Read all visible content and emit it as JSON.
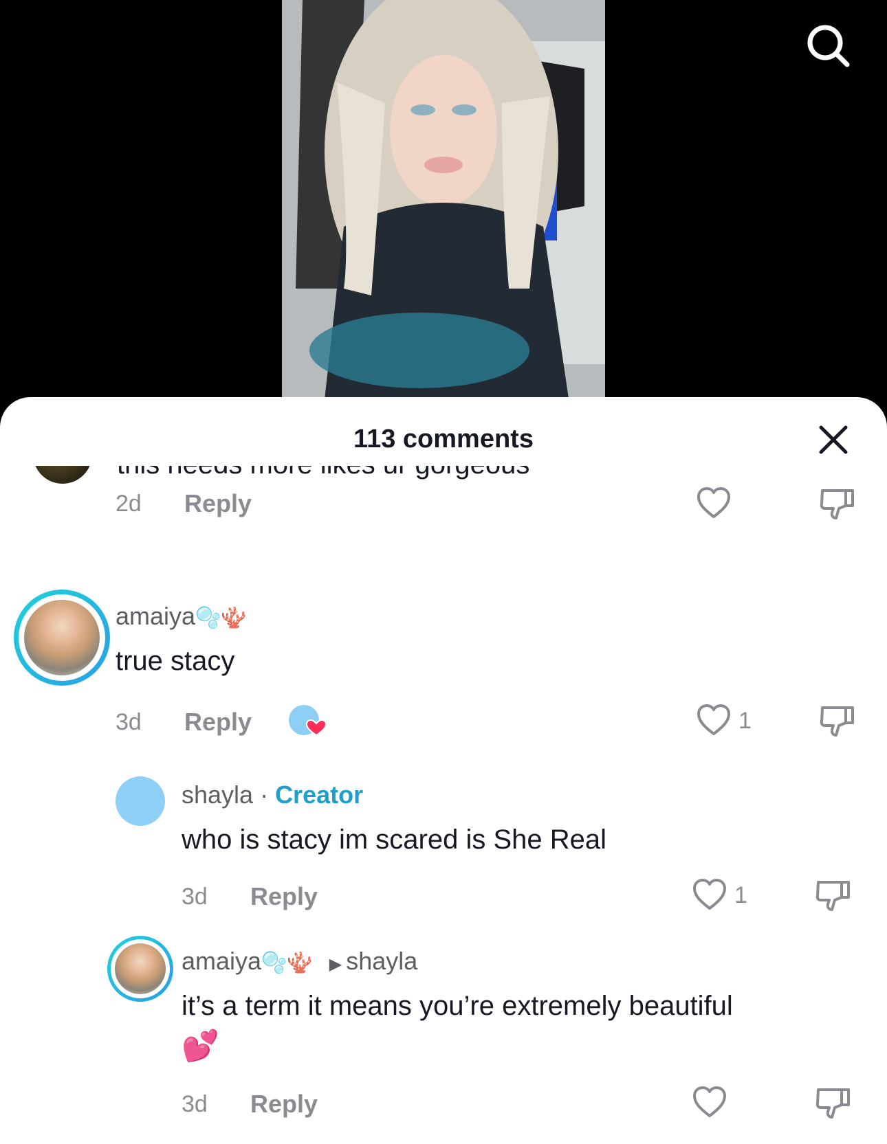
{
  "header": {
    "comments_title": "113 comments"
  },
  "comments": [
    {
      "partial_text": "this needs more likes ur gorgeous",
      "time": "2d",
      "reply_label": "Reply"
    },
    {
      "username": "amaiya",
      "username_emoji": "🫧🪸",
      "text": "true stacy",
      "time": "3d",
      "reply_label": "Reply",
      "likes": "1"
    },
    {
      "username": "shayla",
      "separator": " · ",
      "badge": "Creator",
      "text": "who is stacy im scared is She Real",
      "time": "3d",
      "reply_label": "Reply",
      "likes": "1"
    },
    {
      "username": "amaiya",
      "username_emoji": "🫧🪸",
      "reply_to": "shayla",
      "text": "it’s a term it means you’re extremely beautiful",
      "text_emoji": "💕",
      "time": "3d",
      "reply_label": "Reply"
    }
  ],
  "icons": [
    "search-icon",
    "close-icon",
    "heart-icon",
    "dislike-icon",
    "liked-by-creator-badge"
  ],
  "colors": {
    "accent": "#1f9ec9",
    "ring": "#1ed2d8",
    "creator_avatar": "#8ecff6"
  }
}
